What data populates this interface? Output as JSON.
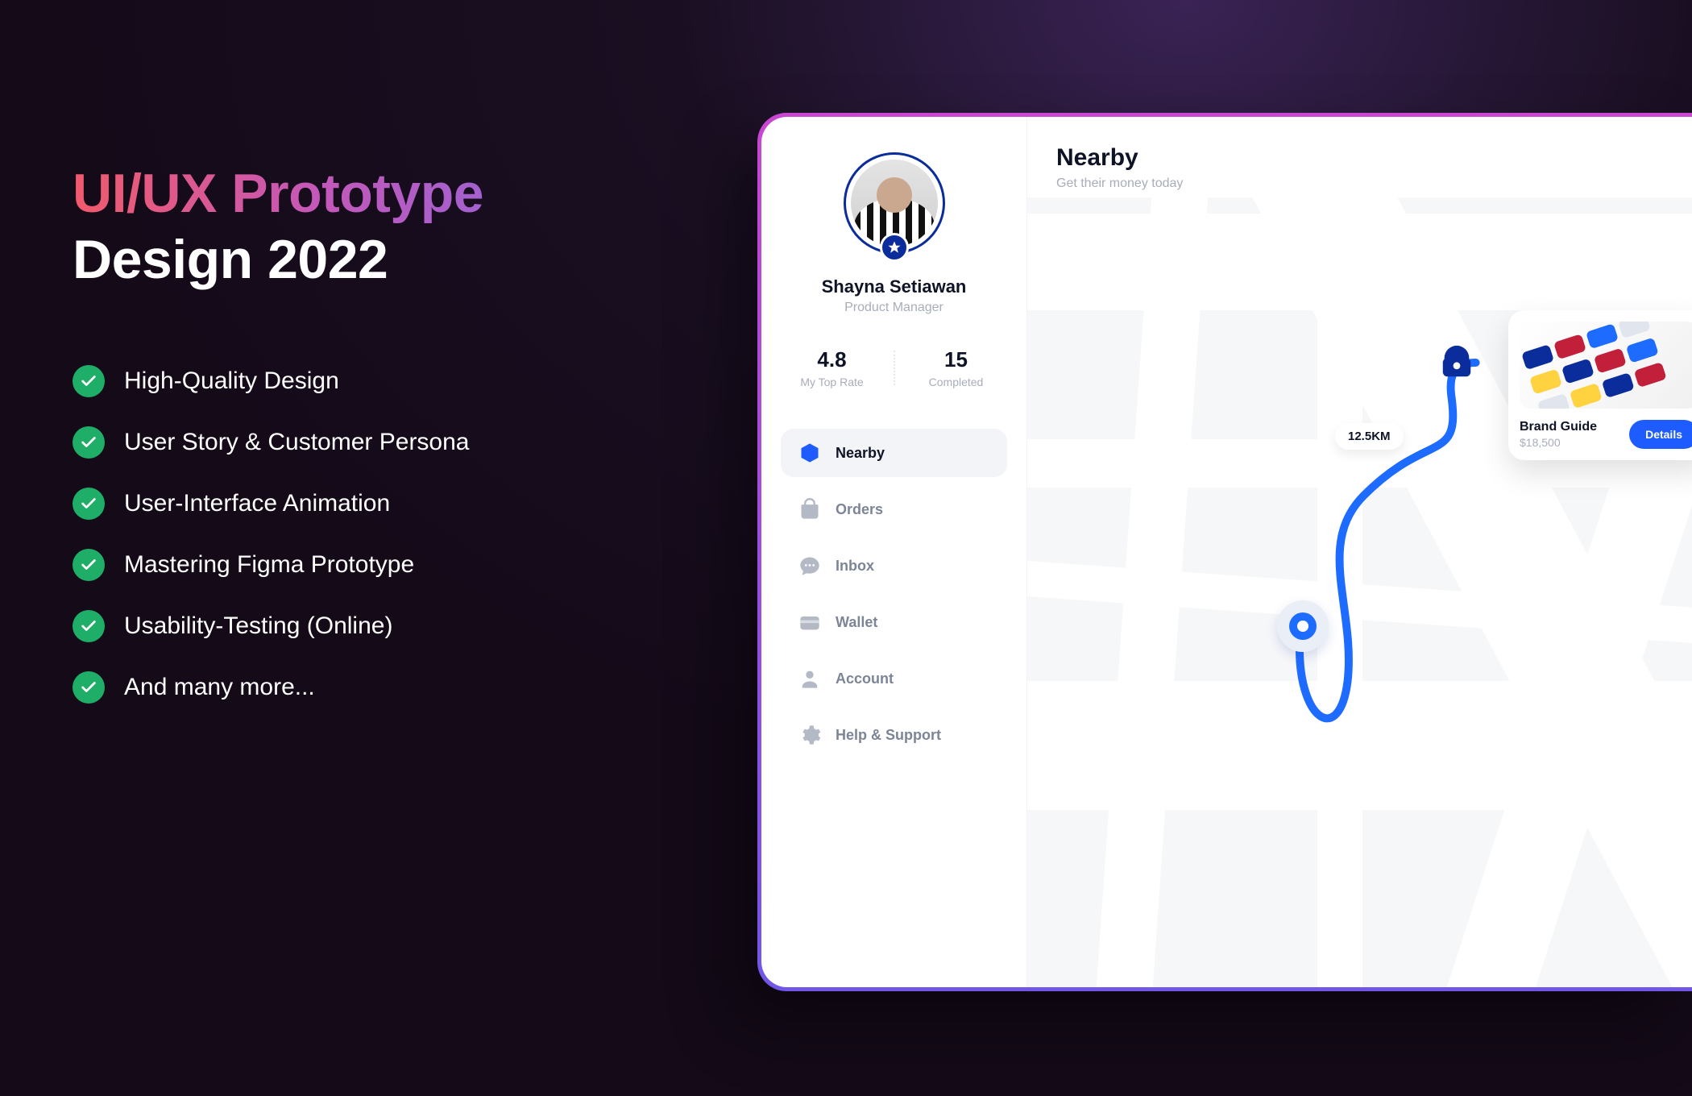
{
  "hero": {
    "title_gradient": "UI/UX Prototype",
    "title_white": "Design 2022",
    "features": [
      "High-Quality Design",
      "User Story & Customer Persona",
      "User-Interface Animation",
      "Mastering Figma Prototype",
      "Usability-Testing (Online)",
      "And many more..."
    ]
  },
  "app": {
    "user": {
      "name": "Shayna Setiawan",
      "role": "Product Manager"
    },
    "stats": {
      "rate": {
        "value": "4.8",
        "label": "My Top Rate"
      },
      "completed": {
        "value": "15",
        "label": "Completed"
      }
    },
    "nav": {
      "nearby": "Nearby",
      "orders": "Orders",
      "inbox": "Inbox",
      "wallet": "Wallet",
      "account": "Account",
      "help": "Help & Support"
    },
    "main": {
      "title": "Nearby",
      "subtitle": "Get their money today",
      "distance": "12.5KM"
    },
    "card": {
      "name": "Brand Guide",
      "price": "$18,500",
      "cta": "Details"
    }
  }
}
